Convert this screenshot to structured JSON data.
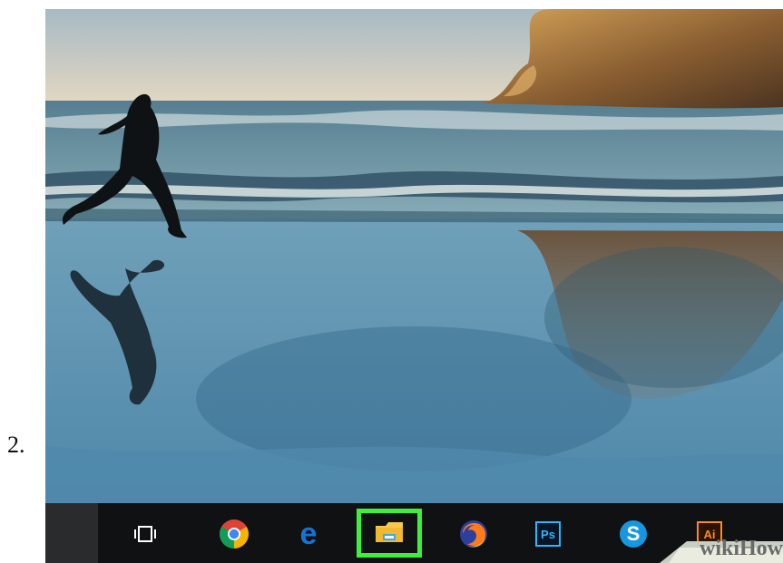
{
  "step": {
    "number": "2."
  },
  "taskbar": {
    "icons": [
      {
        "name": "task-view-icon"
      },
      {
        "name": "chrome-icon"
      },
      {
        "name": "edge-icon",
        "glyph": "e"
      },
      {
        "name": "file-explorer-icon",
        "highlighted": true,
        "highlight_color": "#3cf03c"
      },
      {
        "name": "firefox-icon"
      },
      {
        "name": "photoshop-icon",
        "label": "Ps"
      },
      {
        "name": "skype-icon",
        "label": "S"
      },
      {
        "name": "illustrator-icon",
        "label": "Ai"
      }
    ]
  },
  "watermark": {
    "text": "wikiHow"
  },
  "colors": {
    "taskbar": "#101113",
    "highlight": "#3cf03c",
    "photoshop": "#2fb4ff",
    "illustrator": "#ff8a1f",
    "skype": "#1697e0"
  }
}
